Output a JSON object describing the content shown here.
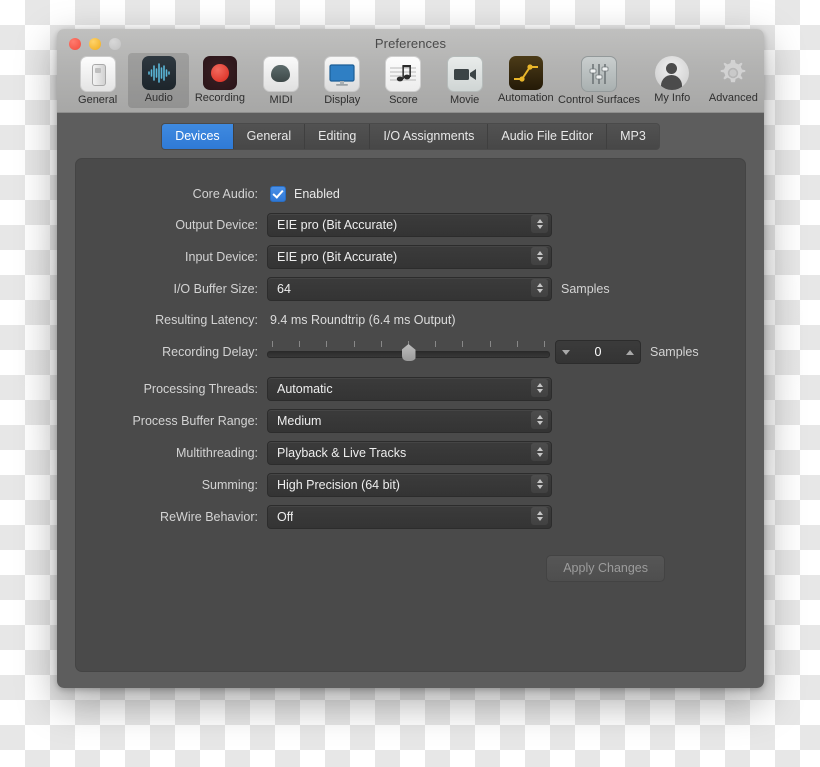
{
  "window": {
    "title": "Preferences",
    "traffic_lights": [
      "close-button",
      "minimize-button",
      "zoom-button"
    ]
  },
  "toolbar": {
    "items": [
      {
        "label": "General",
        "icon": "general-icon",
        "selected": false
      },
      {
        "label": "Audio",
        "icon": "audio-waveform-icon",
        "selected": true
      },
      {
        "label": "Recording",
        "icon": "record-icon",
        "selected": false
      },
      {
        "label": "MIDI",
        "icon": "midi-palette-icon",
        "selected": false
      },
      {
        "label": "Display",
        "icon": "display-monitor-icon",
        "selected": false
      },
      {
        "label": "Score",
        "icon": "score-note-icon",
        "selected": false
      },
      {
        "label": "Movie",
        "icon": "movie-camera-icon",
        "selected": false
      },
      {
        "label": "Automation",
        "icon": "automation-curve-icon",
        "selected": false
      },
      {
        "label": "Control Surfaces",
        "icon": "faders-icon",
        "selected": false
      },
      {
        "label": "My Info",
        "icon": "person-icon",
        "selected": false
      },
      {
        "label": "Advanced",
        "icon": "gear-icon",
        "selected": false
      }
    ]
  },
  "tabs": [
    {
      "label": "Devices",
      "active": true
    },
    {
      "label": "General",
      "active": false
    },
    {
      "label": "Editing",
      "active": false
    },
    {
      "label": "I/O Assignments",
      "active": false
    },
    {
      "label": "Audio File Editor",
      "active": false
    },
    {
      "label": "MP3",
      "active": false
    }
  ],
  "form": {
    "core_audio": {
      "label": "Core Audio:",
      "checkbox_label": "Enabled",
      "checked": true
    },
    "output_device": {
      "label": "Output Device:",
      "value": "EIE pro (Bit Accurate)"
    },
    "input_device": {
      "label": "Input Device:",
      "value": "EIE pro (Bit Accurate)"
    },
    "io_buffer_size": {
      "label": "I/O Buffer Size:",
      "value": "64",
      "suffix": "Samples"
    },
    "resulting_latency": {
      "label": "Resulting Latency:",
      "value": "9.4 ms Roundtrip (6.4 ms Output)"
    },
    "recording_delay": {
      "label": "Recording Delay:",
      "value": "0",
      "suffix": "Samples",
      "slider_position_percent": 50,
      "tick_count": 11
    },
    "processing_threads": {
      "label": "Processing Threads:",
      "value": "Automatic"
    },
    "process_buffer_range": {
      "label": "Process Buffer Range:",
      "value": "Medium"
    },
    "multithreading": {
      "label": "Multithreading:",
      "value": "Playback & Live Tracks"
    },
    "summing": {
      "label": "Summing:",
      "value": "High Precision (64 bit)"
    },
    "rewire_behavior": {
      "label": "ReWire Behavior:",
      "value": "Off"
    },
    "apply_button": {
      "label": "Apply Changes",
      "enabled": false
    }
  },
  "colors": {
    "accent_blue": "#2f7ad6",
    "titlebar_gray": "#b3b3b2",
    "content_gray": "#5d5d5d",
    "panel_gray": "#4a4a4a",
    "field_gray": "#3b3b3b"
  }
}
